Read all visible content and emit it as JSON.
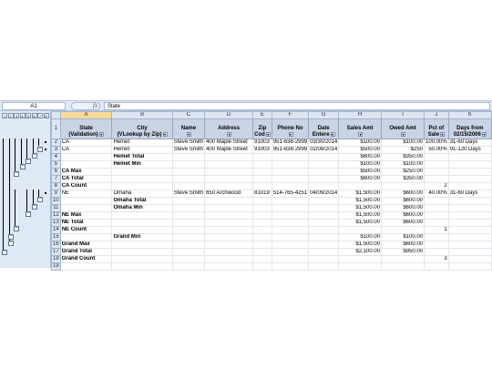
{
  "formula_bar": {
    "name_box": "A1",
    "fx": "fx",
    "value": "State"
  },
  "outline_levels": [
    "1",
    "2",
    "3",
    "4",
    "5",
    "6",
    "7",
    "8"
  ],
  "columns": [
    "A",
    "B",
    "C",
    "D",
    "E",
    "F",
    "G",
    "H",
    "I",
    "J",
    "K"
  ],
  "headers": [
    [
      "State",
      "(Validation)"
    ],
    [
      "City",
      "(VLookup by Zip)"
    ],
    [
      "Name",
      ""
    ],
    [
      "Address",
      ""
    ],
    [
      "Zip",
      "Cod"
    ],
    [
      "Phone No",
      ""
    ],
    [
      "Date",
      "Entere"
    ],
    [
      "Sales Amt",
      ""
    ],
    [
      "Owed Amt",
      ""
    ],
    [
      "Pct of",
      "Sale"
    ],
    [
      "Days from",
      "02/15/2006"
    ]
  ],
  "rows": [
    {
      "num": "2",
      "cells": [
        "CA",
        "Hemet",
        "Steve Smith",
        "400 Maple Street",
        "91003",
        "951-638-2999",
        "03/30/2014",
        "$100.00",
        "$100.00",
        "100.00%",
        "31-60 Days"
      ]
    },
    {
      "num": "3",
      "cells": [
        "CA",
        "Hemet",
        "Steve Smith",
        "400 Maple Street",
        "91003",
        "951-638-2999",
        "02/08/2014",
        "$500.00",
        "$250",
        "50.00%",
        "91-120 Days"
      ]
    },
    {
      "num": "4",
      "cells": [
        "",
        "Hemet Total",
        "",
        "",
        "",
        "",
        "",
        "$600.00",
        "$350.00",
        "",
        ""
      ]
    },
    {
      "num": "5",
      "cells": [
        "",
        "Hemet Min",
        "",
        "",
        "",
        "",
        "",
        "$100.00",
        "$100.00",
        "",
        ""
      ]
    },
    {
      "num": "6",
      "cells": [
        "CA Max",
        "",
        "",
        "",
        "",
        "",
        "",
        "$500.00",
        "$250.00",
        "",
        ""
      ]
    },
    {
      "num": "7",
      "cells": [
        "CA Total",
        "",
        "",
        "",
        "",
        "",
        "",
        "$600.00",
        "$350.00",
        "",
        ""
      ]
    },
    {
      "num": "8",
      "cells": [
        "CA Count",
        "",
        "",
        "",
        "",
        "",
        "",
        "",
        "",
        "2",
        ""
      ]
    },
    {
      "num": "9",
      "cells": [
        "NE",
        "Omaha",
        "Steve Smith",
        "650 Archwood",
        "81019",
        "514-765-4251",
        "04/09/2014",
        "$1,500.00",
        "$600.00",
        "40.00%",
        "31-60 Days"
      ]
    },
    {
      "num": "10",
      "cells": [
        "",
        "Omaha Total",
        "",
        "",
        "",
        "",
        "",
        "$1,500.00",
        "$600.00",
        "",
        ""
      ]
    },
    {
      "num": "11",
      "cells": [
        "",
        "Omaha Min",
        "",
        "",
        "",
        "",
        "",
        "$1,500.00",
        "$600.00",
        "",
        ""
      ]
    },
    {
      "num": "12",
      "cells": [
        "NE Max",
        "",
        "",
        "",
        "",
        "",
        "",
        "$1,500.00",
        "$600.00",
        "",
        ""
      ]
    },
    {
      "num": "13",
      "cells": [
        "NE Total",
        "",
        "",
        "",
        "",
        "",
        "",
        "$1,500.00",
        "$600.00",
        "",
        ""
      ]
    },
    {
      "num": "14",
      "cells": [
        "NE Count",
        "",
        "",
        "",
        "",
        "",
        "",
        "",
        "",
        "1",
        ""
      ]
    },
    {
      "num": "15",
      "cells": [
        "",
        "Grand Min",
        "",
        "",
        "",
        "",
        "",
        "$100.00",
        "$100.00",
        "",
        ""
      ]
    },
    {
      "num": "16",
      "cells": [
        "Grand Max",
        "",
        "",
        "",
        "",
        "",
        "",
        "$1,500.00",
        "$600.00",
        "",
        ""
      ]
    },
    {
      "num": "17",
      "cells": [
        "Grand Total",
        "",
        "",
        "",
        "",
        "",
        "",
        "$2,100.00",
        "$950.00",
        "",
        ""
      ]
    },
    {
      "num": "18",
      "cells": [
        "Grand Count",
        "",
        "",
        "",
        "",
        "",
        "",
        "",
        "",
        "3",
        ""
      ]
    },
    {
      "num": "19",
      "cells": [
        "",
        "",
        "",
        "",
        "",
        "",
        "",
        "",
        "",
        "",
        ""
      ]
    }
  ],
  "icons": {
    "collapse": "minus-icon",
    "dropdown": "filter-dropdown-icon"
  },
  "colors": {
    "header_bg": "#c8d3e4",
    "selected_header": "#f9d99a",
    "chrome": "#dfe8f5"
  }
}
